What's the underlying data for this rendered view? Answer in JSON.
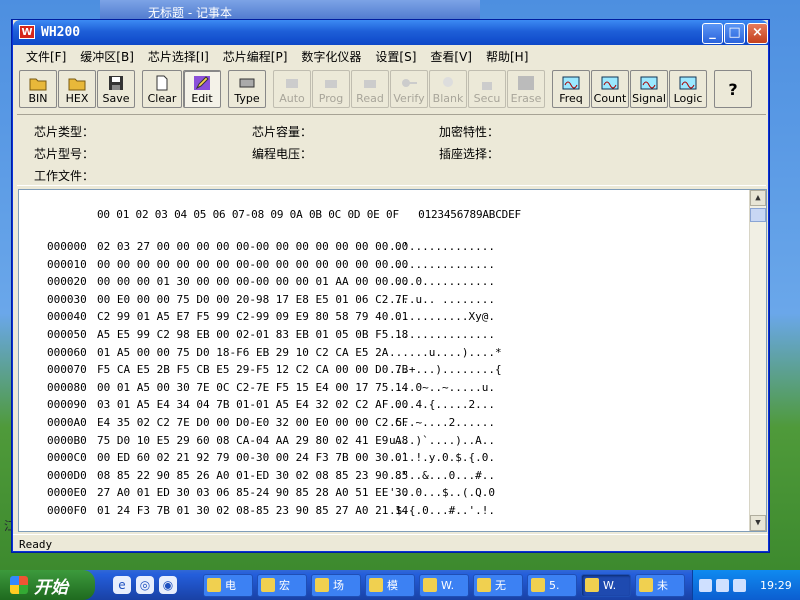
{
  "desktop": {
    "bg_window_title": "无标题 - 记事本",
    "left_char": "江"
  },
  "window": {
    "title": "WH200",
    "logo": "W",
    "minimize_icon": "minimize-icon",
    "maximize_icon": "maximize-icon",
    "close_icon": "close-icon"
  },
  "menu": [
    {
      "label": "文件[F]"
    },
    {
      "label": "缓冲区[B]"
    },
    {
      "label": "芯片选择[I]"
    },
    {
      "label": "芯片编程[P]"
    },
    {
      "label": "数字化仪器"
    },
    {
      "label": "设置[S]"
    },
    {
      "label": "查看[V]"
    },
    {
      "label": "帮助[H]"
    }
  ],
  "toolbar": {
    "bin": "BIN",
    "hex": "HEX",
    "save": "Save",
    "clear": "Clear",
    "edit": "Edit",
    "type": "Type",
    "auto": "Auto",
    "prog": "Prog",
    "read": "Read",
    "verify": "Verify",
    "blank": "Blank",
    "secu": "Secu",
    "erase": "Erase",
    "freq": "Freq",
    "count": "Count",
    "signal": "Signal",
    "logic": "Logic",
    "help": "?"
  },
  "info": {
    "chip_type": "芯片类型：",
    "chip_model": "芯片型号：",
    "work_file": "工作文件：",
    "chip_capacity": "芯片容量：",
    "prog_voltage": "编程电压：",
    "encrypt": "加密特性：",
    "socket": "插座选择："
  },
  "hex": {
    "header_bytes": "00 01 02 03 04 05 06 07-08 09 0A 0B 0C 0D 0E 0F",
    "header_ascii": "0123456789ABCDEF",
    "rows": [
      {
        "addr": "000000",
        "bytes": "02 03 27 00 00 00 00 00-00 00 00 00 00 00 00 00",
        "ascii": "..'............."
      },
      {
        "addr": "000010",
        "bytes": "00 00 00 00 00 00 00 00-00 00 00 00 00 00 00 00",
        "ascii": "................"
      },
      {
        "addr": "000020",
        "bytes": "00 00 00 01 30 00 00 00-00 00 00 01 AA 00 00 00",
        "ascii": "....0..........."
      },
      {
        "addr": "000030",
        "bytes": "00 E0 00 00 75 D0 00 20-98 17 E8 E5 01 06 C2 7F",
        "ascii": "....u.. ........"
      },
      {
        "addr": "000040",
        "bytes": "C2 99 01 A5 E7 F5 99 C2-99 09 E9 80 58 79 40 01",
        "ascii": "............Xy@."
      },
      {
        "addr": "000050",
        "bytes": "A5 E5 99 C2 98 EB 00 02-01 83 EB 01 05 0B F5 18",
        "ascii": "................"
      },
      {
        "addr": "000060",
        "bytes": "01 A5 00 00 75 D0 18-F6 EB 29 10 C2 CA E5 2A",
        "ascii": "......u....)....*"
      },
      {
        "addr": "000070",
        "bytes": "F5 CA E5 2B F5 CB E5 29-F5 12 C2 CA 00 00 D0 7B",
        "ascii": "...+...)........{"
      },
      {
        "addr": "000080",
        "bytes": "00 01 A5 00 30 7E 0C C2-7E F5 15 E4 00 17 75 14",
        "ascii": "....0~..~.....u."
      },
      {
        "addr": "000090",
        "bytes": "03 01 A5 E4 34 04 7B 01-01 A5 E4 32 02 C2 AF 00",
        "ascii": "....4.{.....2..."
      },
      {
        "addr": "0000A0",
        "bytes": "E4 35 02 C2 7E D0 00 D0-E0 32 00 E0 00 00 C2 CF",
        "ascii": ".5..~....2......"
      },
      {
        "addr": "0000B0",
        "bytes": "75 D0 10 E5 29 60 08 CA-04 AA 29 80 02 41 E9 A8",
        "ascii": "u...)`....)..A.."
      },
      {
        "addr": "0000C0",
        "bytes": "00 ED 60 02 21 92 79 00-30 00 24 F3 7B 00 30 01",
        "ascii": "..`.!.y.0.$.{.0."
      },
      {
        "addr": "0000D0",
        "bytes": "08 85 22 90 85 26 A0 01-ED 30 02 08 85 23 90 85",
        "ascii": "..\"..&...0...#.."
      },
      {
        "addr": "0000E0",
        "bytes": "27 A0 01 ED 30 03 06 85-24 90 85 28 A0 51 EE 30",
        "ascii": "'...0...$..(.Q.0"
      },
      {
        "addr": "0000F0",
        "bytes": "01 24 F3 7B 01 30 02 08-85 23 90 85 27 A0 21 14",
        "ascii": ".$.{.0...#..'.!."
      }
    ]
  },
  "status": "Ready",
  "taskbar": {
    "start": "开始",
    "tasks": [
      {
        "label": "电"
      },
      {
        "label": "宏"
      },
      {
        "label": "场"
      },
      {
        "label": "模"
      },
      {
        "label": "W."
      },
      {
        "label": "无"
      },
      {
        "label": "5."
      },
      {
        "label": "W."
      },
      {
        "label": "未"
      }
    ],
    "clock": "19:29"
  }
}
